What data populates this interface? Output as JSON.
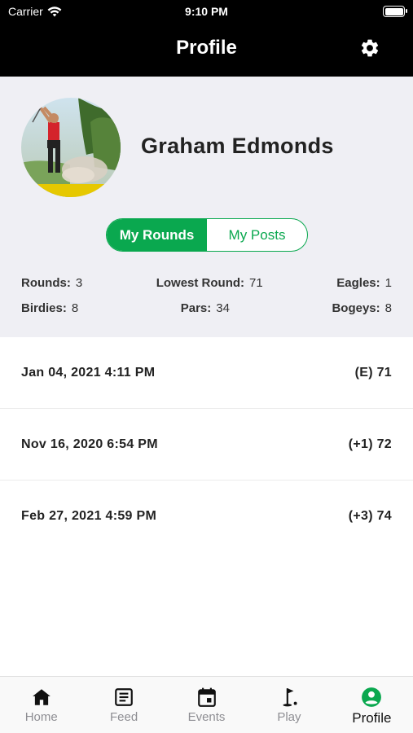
{
  "status_bar": {
    "carrier": "Carrier",
    "time": "9:10 PM",
    "battery_level": 1.0
  },
  "nav": {
    "title": "Profile",
    "settings_icon": "gear-icon"
  },
  "profile": {
    "name": "Graham Edmonds"
  },
  "segments": {
    "rounds_label": "My Rounds",
    "posts_label": "My Posts",
    "selected": "My Rounds"
  },
  "stats": {
    "rounds_label": "Rounds:",
    "rounds_value": "3",
    "lowest_label": "Lowest Round:",
    "lowest_value": "71",
    "eagles_label": "Eagles:",
    "eagles_value": "1",
    "birdies_label": "Birdies:",
    "birdies_value": "8",
    "pars_label": "Pars:",
    "pars_value": "34",
    "bogeys_label": "Bogeys:",
    "bogeys_value": "8"
  },
  "rounds": [
    {
      "date": "Jan 04, 2021 4:11 PM",
      "score": "(E) 71"
    },
    {
      "date": "Nov 16, 2020 6:54 PM",
      "score": "(+1) 72"
    },
    {
      "date": "Feb 27, 2021 4:59 PM",
      "score": "(+3) 74"
    }
  ],
  "tabs": [
    {
      "label": "Home",
      "icon": "home-icon"
    },
    {
      "label": "Feed",
      "icon": "feed-icon"
    },
    {
      "label": "Events",
      "icon": "calendar-icon"
    },
    {
      "label": "Play",
      "icon": "golf-flag-icon"
    },
    {
      "label": "Profile",
      "icon": "profile-icon",
      "active": true
    }
  ],
  "colors": {
    "accent": "#0aa84f",
    "header_bg": "#000000",
    "profile_bg": "#efeff4"
  }
}
